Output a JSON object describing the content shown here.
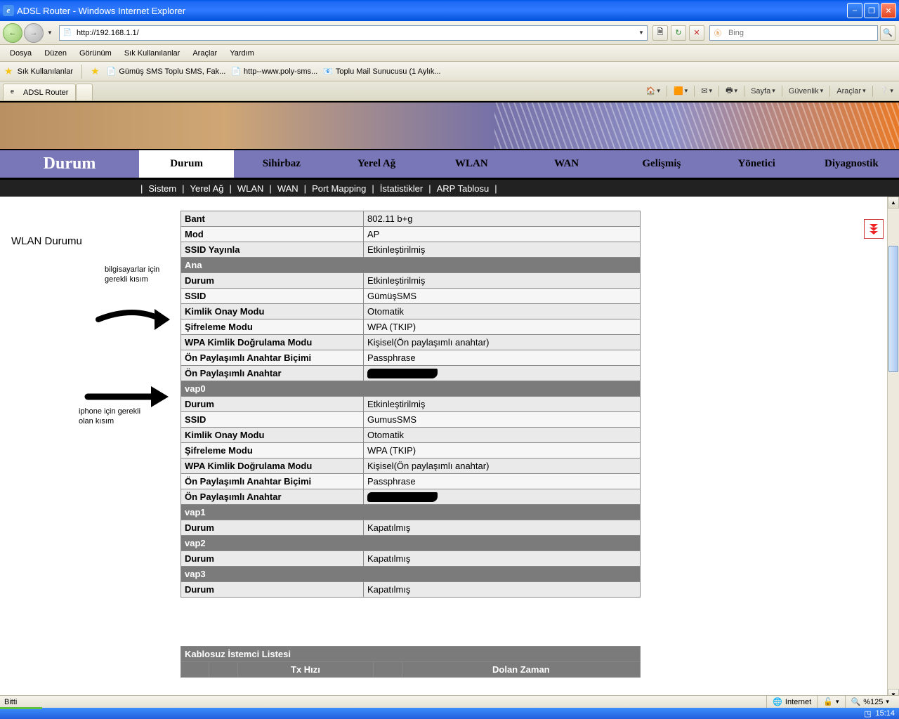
{
  "window": {
    "title": "ADSL Router - Windows Internet Explorer"
  },
  "address": {
    "url": "http://192.168.1.1/"
  },
  "search": {
    "placeholder": "Bing"
  },
  "menu": {
    "file": "Dosya",
    "edit": "Düzen",
    "view": "Görünüm",
    "favorites": "Sık Kullanılanlar",
    "tools": "Araçlar",
    "help": "Yardım"
  },
  "favbar": {
    "label": "Sık Kullanılanlar",
    "links": [
      "Gümüş SMS  Toplu SMS, Fak...",
      "http--www.poly-sms...",
      "Toplu Mail Sunucusu (1 Aylık..."
    ]
  },
  "tab": {
    "title": "ADSL Router"
  },
  "tabtools": {
    "page": "Sayfa",
    "safety": "Güvenlik",
    "tools": "Araçlar"
  },
  "mainnav": {
    "lead": "Durum",
    "items": [
      "Durum",
      "Sihirbaz",
      "Yerel Ağ",
      "WLAN",
      "WAN",
      "Gelişmiş",
      "Yönetici",
      "Diyagnostik"
    ]
  },
  "subnav": [
    "Sistem",
    "Yerel Ağ",
    "WLAN",
    "WAN",
    "Port Mapping",
    "İstatistikler",
    "ARP Tablosu"
  ],
  "side": {
    "title": "WLAN Durumu"
  },
  "annot1": "bilgisayarlar için\ngerekli kısım",
  "annot2": "iphone için gerekli\nolan kısım",
  "table": {
    "rows": [
      {
        "t": "row",
        "label": "Bant",
        "val": "802.11 b+g"
      },
      {
        "t": "row",
        "label": "Mod",
        "val": "AP"
      },
      {
        "t": "row",
        "label": "SSID Yayınla",
        "val": "Etkinleştirilmiş"
      },
      {
        "t": "sec",
        "label": "Ana"
      },
      {
        "t": "row",
        "label": "Durum",
        "val": "Etkinleştirilmiş"
      },
      {
        "t": "row",
        "label": "SSID",
        "val": "GümüşSMS"
      },
      {
        "t": "row",
        "label": "Kimlik Onay Modu",
        "val": "Otomatik"
      },
      {
        "t": "row",
        "label": "Şifreleme Modu",
        "val": "WPA (TKIP)"
      },
      {
        "t": "row",
        "label": "WPA Kimlik Doğrulama Modu",
        "val": "Kişisel(Ön paylaşımlı anahtar)"
      },
      {
        "t": "row",
        "label": "Ön Paylaşımlı Anahtar Biçimi",
        "val": "Passphrase"
      },
      {
        "t": "row",
        "label": "Ön Paylaşımlı Anahtar",
        "val": "[REDACTED]"
      },
      {
        "t": "sec",
        "label": "vap0"
      },
      {
        "t": "row",
        "label": "Durum",
        "val": "Etkinleştirilmiş"
      },
      {
        "t": "row",
        "label": "SSID",
        "val": "GumusSMS"
      },
      {
        "t": "row",
        "label": "Kimlik Onay Modu",
        "val": "Otomatik"
      },
      {
        "t": "row",
        "label": "Şifreleme Modu",
        "val": "WPA (TKIP)"
      },
      {
        "t": "row",
        "label": "WPA Kimlik Doğrulama Modu",
        "val": "Kişisel(Ön paylaşımlı anahtar)"
      },
      {
        "t": "row",
        "label": "Ön Paylaşımlı Anahtar Biçimi",
        "val": "Passphrase"
      },
      {
        "t": "row",
        "label": "Ön Paylaşımlı Anahtar",
        "val": "[REDACTED]"
      },
      {
        "t": "sec",
        "label": "vap1"
      },
      {
        "t": "row",
        "label": "Durum",
        "val": "Kapatılmış"
      },
      {
        "t": "sec",
        "label": "vap2"
      },
      {
        "t": "row",
        "label": "Durum",
        "val": "Kapatılmış"
      },
      {
        "t": "sec",
        "label": "vap3"
      },
      {
        "t": "row",
        "label": "Durum",
        "val": "Kapatılmış"
      }
    ]
  },
  "clients": {
    "title": "Kablosuz İstemci Listesi",
    "cols": [
      "",
      "",
      "Tx Hızı",
      "",
      "Dolan Zaman"
    ]
  },
  "status": {
    "done": "Bitti",
    "zone": "Internet",
    "zoom": "%125"
  },
  "clock": "15:14"
}
